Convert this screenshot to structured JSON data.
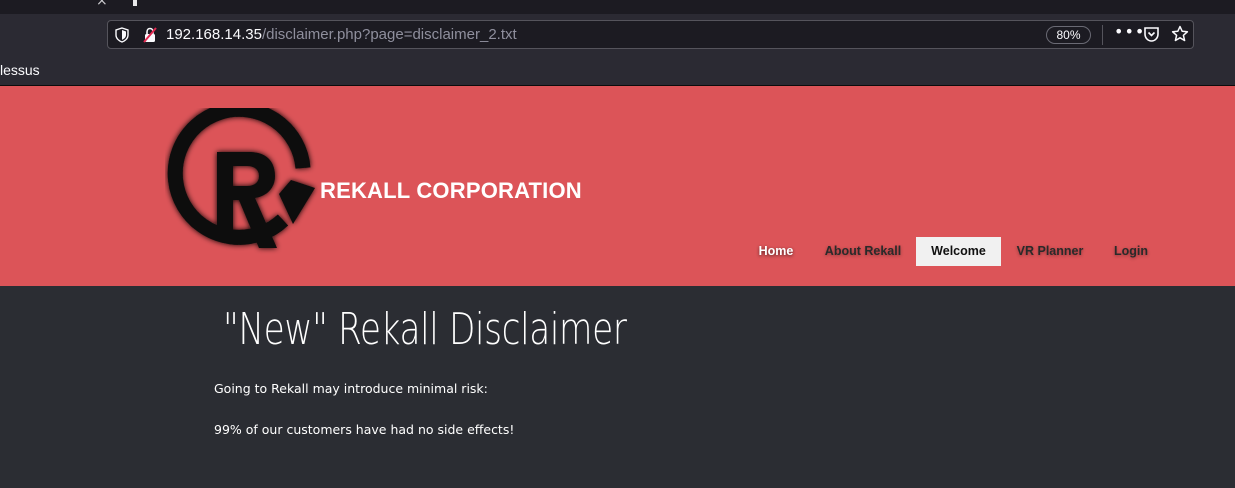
{
  "browser": {
    "tab_close_glyph": "×",
    "url_host": "192.168.14.35",
    "url_path": "/disclaimer.php?page=disclaimer_2.txt",
    "zoom": "80%",
    "more_glyph": "•••",
    "bookmark_label": "lessus"
  },
  "header": {
    "brand": "REKALL CORPORATION",
    "background_color": "#dc5458",
    "nav": [
      {
        "label": "Home",
        "active": false
      },
      {
        "label": "About Rekall",
        "active": false
      },
      {
        "label": "Welcome",
        "active": true
      },
      {
        "label": "VR Planner",
        "active": false
      },
      {
        "label": "Login",
        "active": false
      }
    ]
  },
  "main": {
    "title": "\"New\" Rekall Disclaimer",
    "paragraphs": [
      "Going to Rekall may introduce minimal risk:",
      "99% of our customers have had no side effects!"
    ]
  }
}
